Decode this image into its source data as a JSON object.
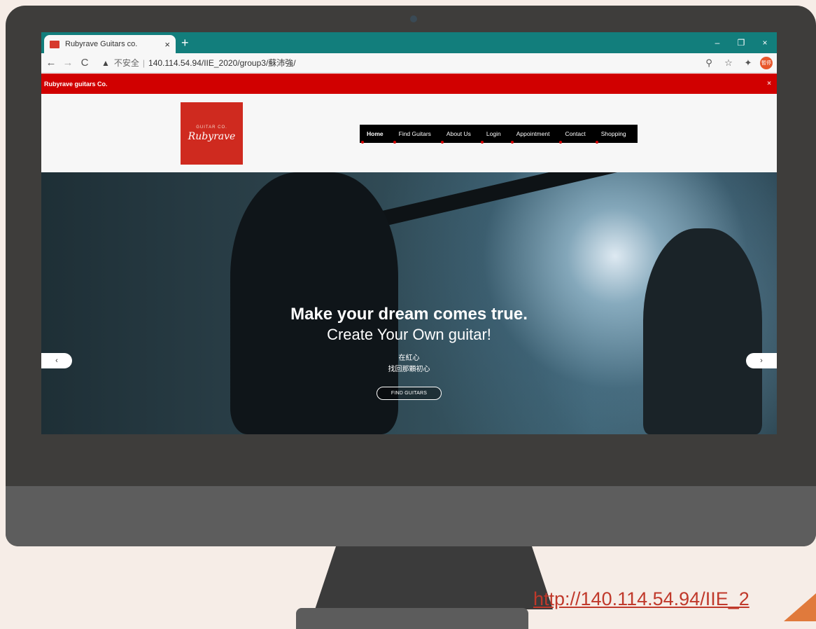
{
  "browser": {
    "tab_title": "Rubyrave Guitars co.",
    "tab_close": "×",
    "new_tab": "+",
    "win_min": "–",
    "win_restore": "❐",
    "win_close": "×",
    "nav_back": "←",
    "nav_forward": "→",
    "nav_reload": "C",
    "warning_icon": "▲",
    "insecure_label": "不安全",
    "separator": "|",
    "url": "140.114.54.94/IIE_2020/group3/蘇沛強/",
    "zoom_icon": "⚲",
    "star_icon": "☆",
    "extension_icon": "✦",
    "profile_label": "暫停"
  },
  "announcement": {
    "text": "Rubyrave guitars Co.",
    "close": "×"
  },
  "logo": {
    "subtitle": "GUITAR CO.",
    "name": "Rubyrave"
  },
  "menu": [
    {
      "label": "Home",
      "active": true
    },
    {
      "label": "Find Guitars"
    },
    {
      "label": "About Us"
    },
    {
      "label": "Login"
    },
    {
      "label": "Appointment"
    },
    {
      "label": "Contact"
    },
    {
      "label": "Shopping"
    }
  ],
  "hero": {
    "title": "Make your dream comes true.",
    "subtitle": "Create Your Own guitar!",
    "line1": "在紅心",
    "line2": "找回那顆初心",
    "button": "FIND GUITARS",
    "prev": "‹",
    "next": "›"
  },
  "promo_link": "http://140.114.54.94/IIE_2"
}
